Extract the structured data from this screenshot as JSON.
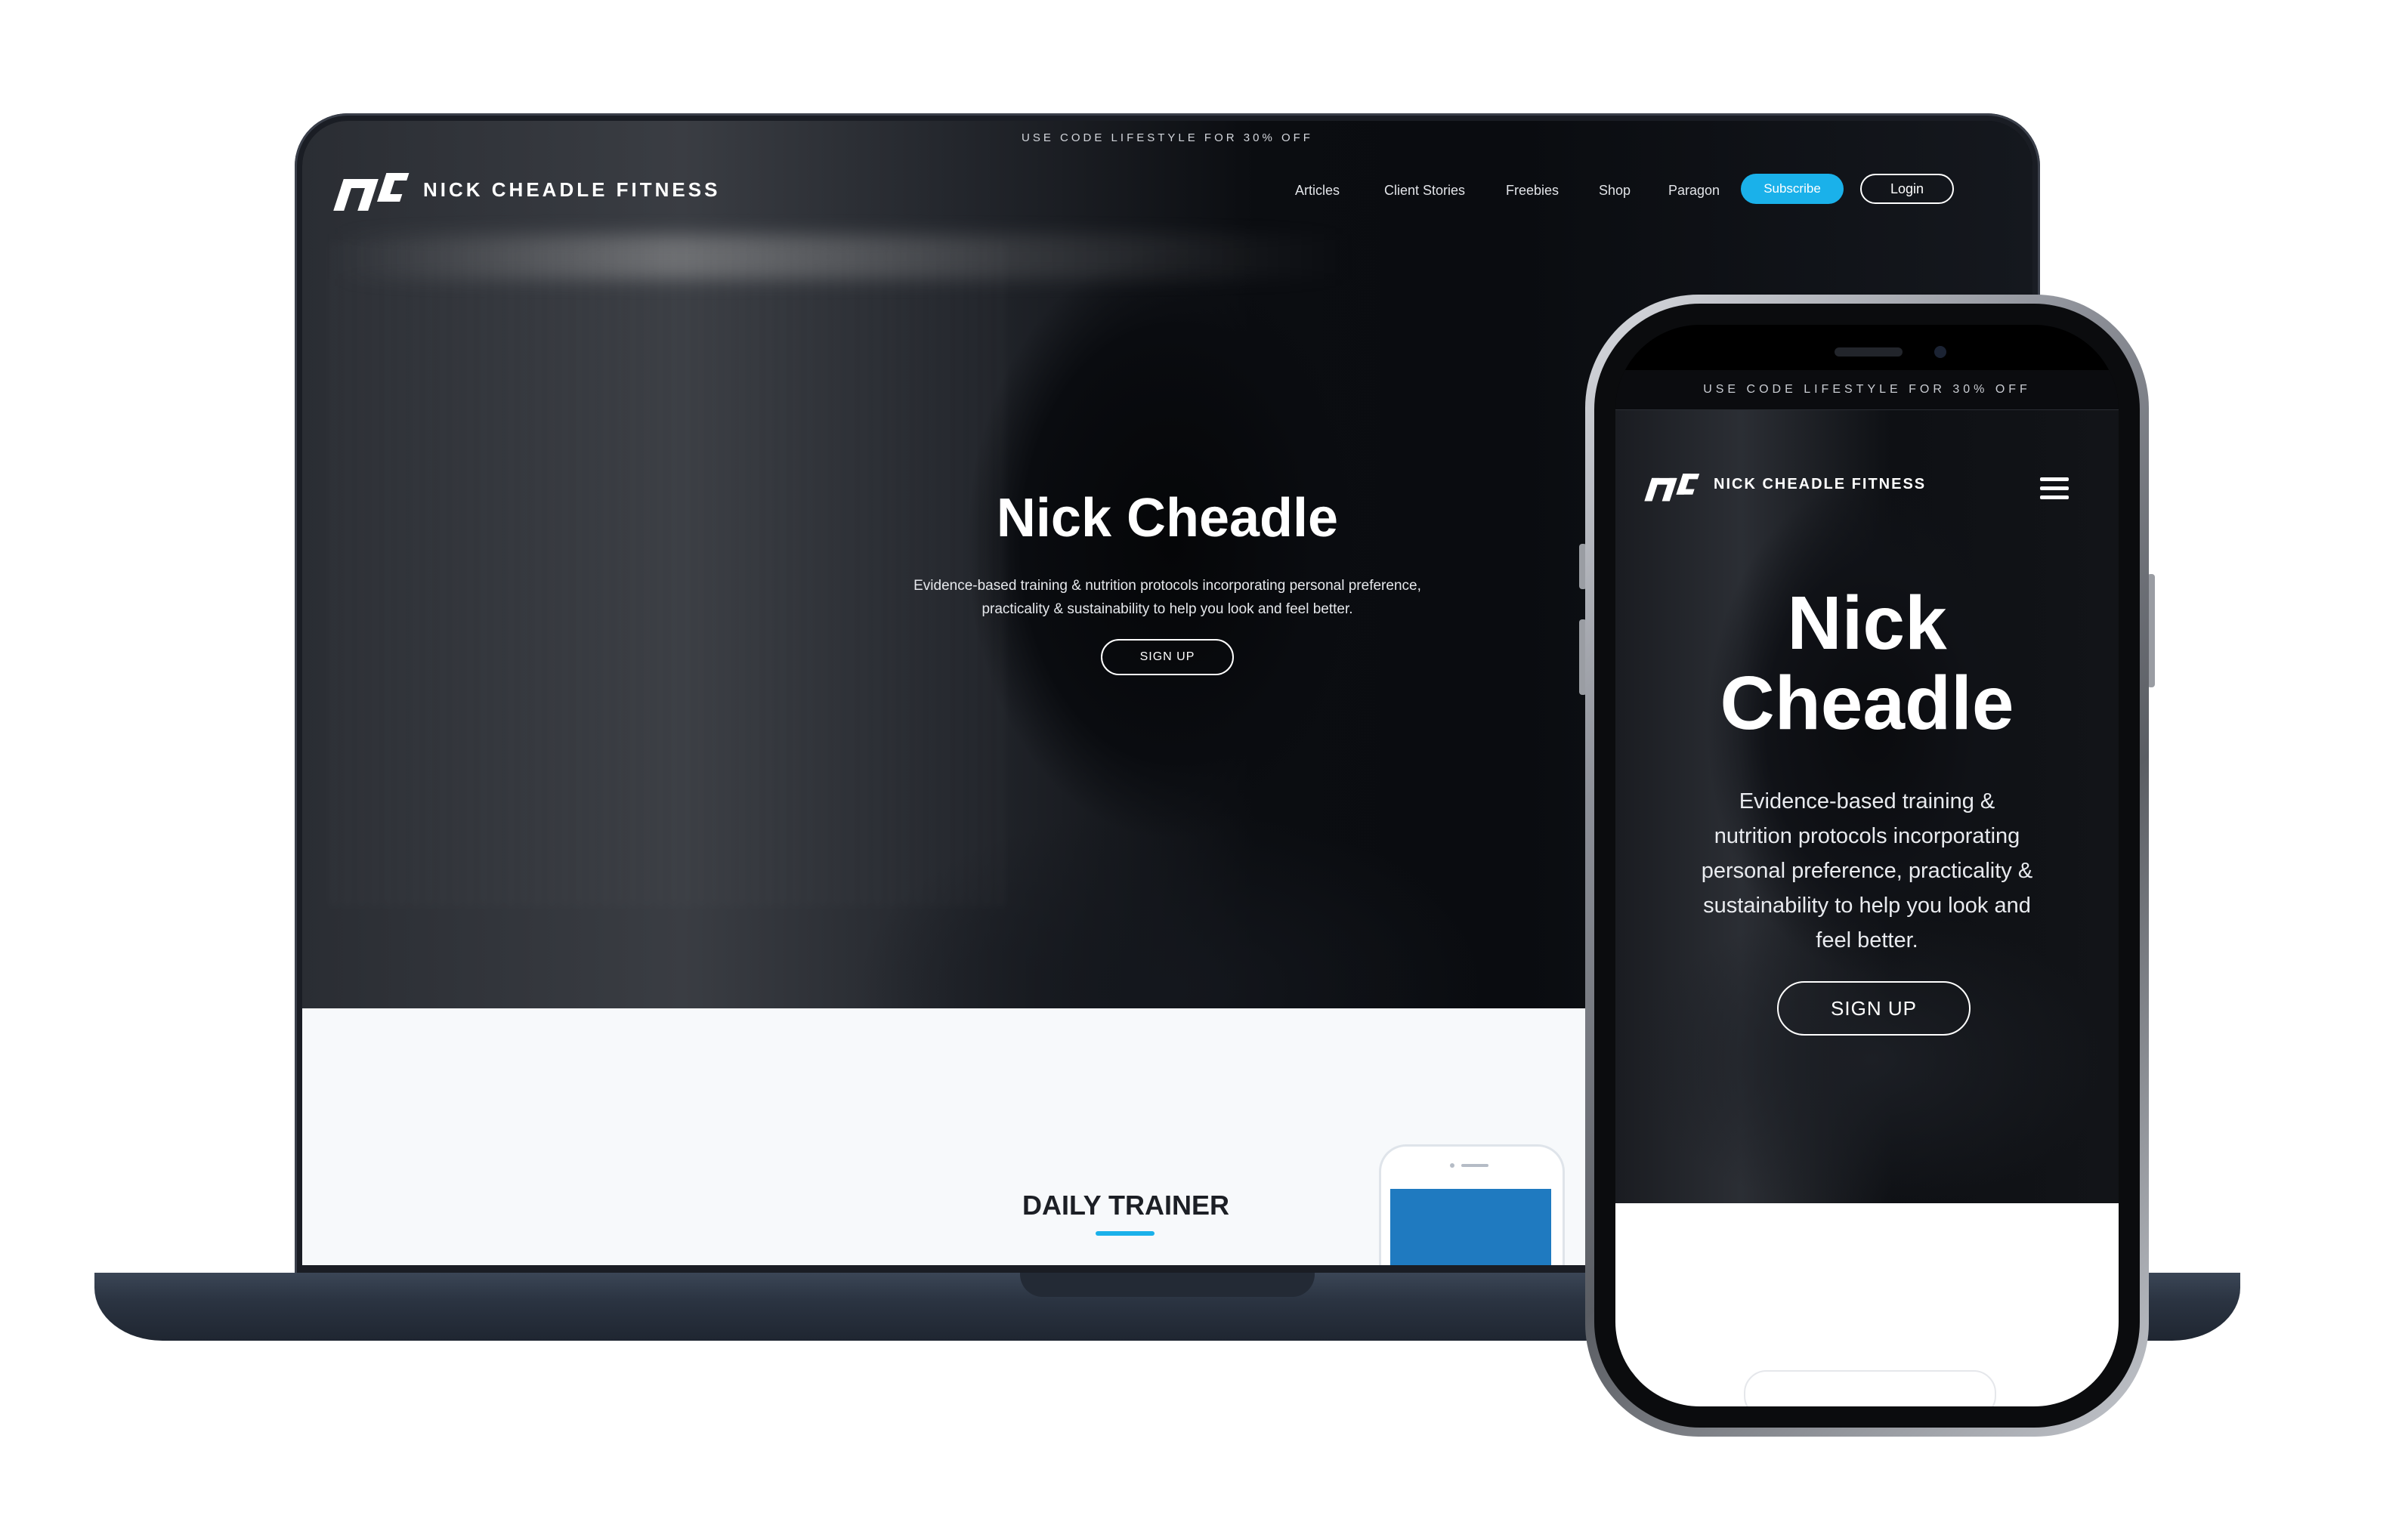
{
  "desktop": {
    "promo_text": "USE CODE LIFESTYLE FOR 30% OFF",
    "brand": "NICK CHEADLE FITNESS",
    "nav": {
      "articles": "Articles",
      "client_stories": "Client Stories",
      "freebies": "Freebies",
      "shop": "Shop",
      "paragon": "Paragon",
      "subscribe": "Subscribe",
      "login": "Login"
    },
    "hero": {
      "title": "Nick Cheadle",
      "subtitle_line1": "Evidence-based training & nutrition protocols incorporating personal preference,",
      "subtitle_line2": "practicality & sustainability to help you look and feel better.",
      "cta": "SIGN UP"
    },
    "section_title": "DAILY TRAINER"
  },
  "mobile": {
    "promo_text": "USE CODE LIFESTYLE FOR 30% OFF",
    "brand": "NICK CHEADLE FITNESS",
    "hero": {
      "title_line1": "Nick",
      "title_line2": "Cheadle",
      "subtitle_line1": "Evidence-based training &",
      "subtitle_line2": "nutrition protocols incorporating",
      "subtitle_line3": "personal preference, practicality &",
      "subtitle_line4": "sustainability to help you look and",
      "subtitle_line5": "feel better.",
      "cta": "SIGN UP"
    }
  },
  "colors": {
    "accent": "#1ab1ea",
    "hero_bg": "#05070b",
    "laptop_frame": "#2b3442"
  },
  "icons": [
    "nc-logo-icon",
    "hamburger-menu-icon"
  ]
}
